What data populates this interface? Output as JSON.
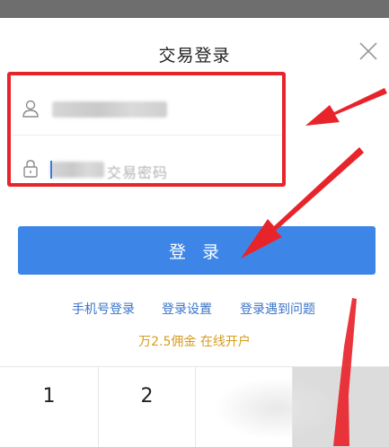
{
  "dialog": {
    "title": "交易登录",
    "close_icon": "close-icon"
  },
  "form": {
    "account_icon": "user-icon",
    "password_icon": "lock-icon",
    "password_placeholder": "交易密码",
    "account_value_obscured": true,
    "password_value_obscured": true
  },
  "login_button": {
    "label": "登 录",
    "color": "#3d86e8"
  },
  "links": {
    "phone_login": "手机号登录",
    "login_settings": "登录设置",
    "login_problem": "登录遇到问题"
  },
  "promo": {
    "text": "万2.5佣金 在线开户",
    "color": "#d89b1c"
  },
  "keypad": {
    "keys": [
      "1",
      "2",
      "",
      ""
    ]
  },
  "annotation": {
    "highlight_color": "#e8242b",
    "arrow_color": "#e8242b"
  }
}
